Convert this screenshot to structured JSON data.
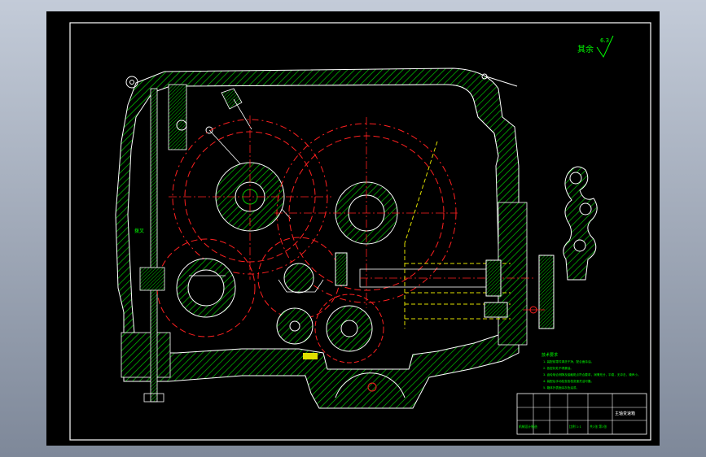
{
  "app": {
    "background_top": "#c3cbd8",
    "background_bottom": "#7e8899",
    "sheet_color": "#000000"
  },
  "colors": {
    "frame": "#ffffff",
    "outline": "#ffffff",
    "hatch": "#00c800",
    "centerline": "#ff2020",
    "hidden": "#e0e000",
    "annotation": "#00ff00",
    "part_label": "#00ff00"
  },
  "roughness_symbol": {
    "text": "其余",
    "value": "6.3",
    "icon": "roughness-triangle-icon"
  },
  "part_label": {
    "text": "拨叉"
  },
  "tech_notes": {
    "title": "技术要求",
    "lines": [
      "1. 装配前零件清洗干净，配合面涂油。",
      "2. 各密封处不得漏油。",
      "3. 齿轮啮合侧隙及接触斑点符合要求，润滑充分，平稳，无冲击，噪声小。",
      "4. 装配后手动检查各档变速灵活可靠。",
      "5. 箱体外表面涂灰色油漆。"
    ]
  },
  "title_block": {
    "drawing_title": "主轴变速箱",
    "scale_label": "比例 1:1",
    "sheet_label": "共1张 第1张",
    "school_label": "机械设计制造"
  }
}
